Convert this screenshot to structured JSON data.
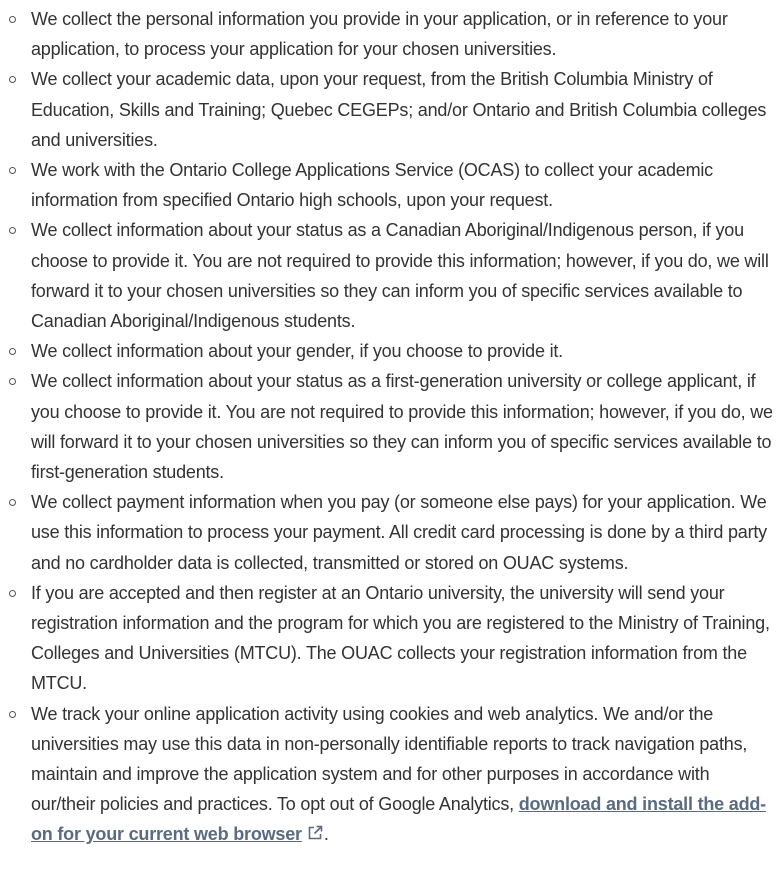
{
  "items": [
    "We collect the personal information you provide in your application, or in reference to your application, to process your application for your chosen universities.",
    "We collect your academic data, upon your request, from the British Columbia Ministry of Education, Skills and Training; Quebec CEGEPs; and/or Ontario and British Columbia colleges and universities.",
    "We work with the Ontario College Applications Service (OCAS) to collect your academic information from specified Ontario high schools, upon your request.",
    "We collect information about your status as a Canadian Aboriginal/Indigenous person, if you choose to provide it. You are not required to provide this information; however, if you do, we will forward it to your chosen universities so they can inform you of specific services available to Canadian Aboriginal/Indigenous students.",
    "We collect information about your gender, if you choose to provide it.",
    "We collect information about your status as a first-generation university or college applicant, if you choose to provide it. You are not required to provide this information; however, if you do, we will forward it to your chosen universities so they can inform you of specific services available to first-generation students.",
    "We collect payment information when you pay (or someone else pays) for your application. We use this information to process your payment. All credit card processing is done by a third party and no cardholder data is collected, transmitted or stored on OUAC systems.",
    "If you are accepted and then register at an Ontario university, the university will send your registration information and the program for which you are registered to the Ministry of Training, Colleges and Universities (MTCU). The OUAC collects your registration information from the MTCU."
  ],
  "last_item": {
    "text": "We track your online application activity using cookies and web analytics. We and/or the universities may use this data in non-personally identifiable reports to track navigation paths, maintain and improve the application system and for other purposes in accordance with our/their policies and practices. To opt out of Google Analytics, ",
    "link_text": "download and install the add-on for your current web browser",
    "link_icon": "external-link-icon",
    "after_link": "."
  }
}
